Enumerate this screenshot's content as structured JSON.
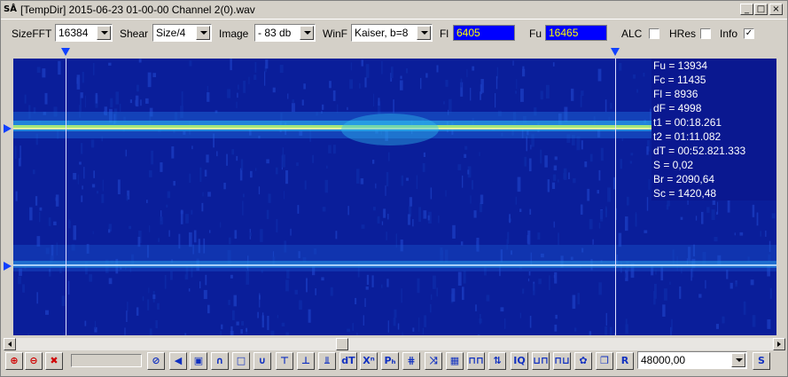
{
  "window": {
    "logo_text": "SÅ",
    "title": "[TempDir] 2015-06-23 01-00-00 Channel 2(0).wav",
    "minimize_glyph": "_",
    "maximize_glyph": "□",
    "close_glyph": "×"
  },
  "toolbar": {
    "sizefft_label": "SizeFFT",
    "sizefft_value": "16384",
    "shear_label": "Shear",
    "shear_value": "Size/4",
    "image_label": "Image",
    "image_value": "- 83 db",
    "winf_label": "WinF",
    "winf_value": "Kaiser, b=8",
    "fl_label": "Fl",
    "fl_value": "6405",
    "fu_label": "Fu",
    "fu_value": "16465",
    "alc_label": "ALC",
    "alc_checked": false,
    "hres_label": "HRes",
    "hres_checked": false,
    "info_label": "Info",
    "info_checked": true,
    "check_mark": "✓"
  },
  "readout": {
    "lines": [
      "Fu = 13934",
      "Fc = 11435",
      "Fl = 8936",
      "dF = 4998",
      "t1 = 00:18.261",
      "t2 = 01:11.082",
      "dT = 00:52.821.333",
      "S = 0,02",
      "Br = 2090,64",
      "Sc = 1420,48"
    ]
  },
  "bottombar": {
    "samplerate_value": "48000,00",
    "buttons": [
      {
        "name": "zoom-in-icon",
        "glyph": "⊕",
        "red": true
      },
      {
        "name": "zoom-out-icon",
        "glyph": "⊖",
        "red": true
      },
      {
        "name": "zoom-reset-icon",
        "glyph": "✖",
        "red": true
      },
      {
        "name": "stop-icon",
        "glyph": "⊘",
        "red": false
      },
      {
        "name": "speaker-icon",
        "glyph": "◀",
        "red": false
      },
      {
        "name": "frame-icon",
        "glyph": "▣",
        "red": false
      },
      {
        "name": "arc-up-icon",
        "glyph": "∩",
        "red": false
      },
      {
        "name": "rectangle-icon",
        "glyph": "□",
        "red": false
      },
      {
        "name": "arc-down-icon",
        "glyph": "∪",
        "red": false
      },
      {
        "name": "marker-top-icon",
        "glyph": "⊤",
        "red": false
      },
      {
        "name": "marker-bottom-icon",
        "glyph": "⊥",
        "red": false
      },
      {
        "name": "marker-both-icon",
        "glyph": "⫫",
        "red": false
      },
      {
        "name": "dt-icon",
        "glyph": "dT",
        "red": false
      },
      {
        "name": "xn-icon",
        "glyph": "Xⁿ",
        "red": false
      },
      {
        "name": "ph-icon",
        "glyph": "Pₕ",
        "red": false
      },
      {
        "name": "comb-icon",
        "glyph": "⋕",
        "red": false
      },
      {
        "name": "swap-icon",
        "glyph": "⤨",
        "red": false
      },
      {
        "name": "grid-icon",
        "glyph": "▦",
        "red": false
      },
      {
        "name": "pulse-icon",
        "glyph": "⊓⊓",
        "red": false
      },
      {
        "name": "updown-icon",
        "glyph": "⇅",
        "red": false
      },
      {
        "name": "iq-icon",
        "glyph": "IQ",
        "red": false
      },
      {
        "name": "wave-icon",
        "glyph": "⊔⊓",
        "red": false
      },
      {
        "name": "wave2-icon",
        "glyph": "⊓⊔",
        "red": false
      },
      {
        "name": "gear-icon",
        "glyph": "✿",
        "red": false
      },
      {
        "name": "copy-icon",
        "glyph": "❐",
        "red": false
      },
      {
        "name": "r-icon",
        "glyph": "R",
        "red": false
      }
    ],
    "s_button": "S"
  }
}
